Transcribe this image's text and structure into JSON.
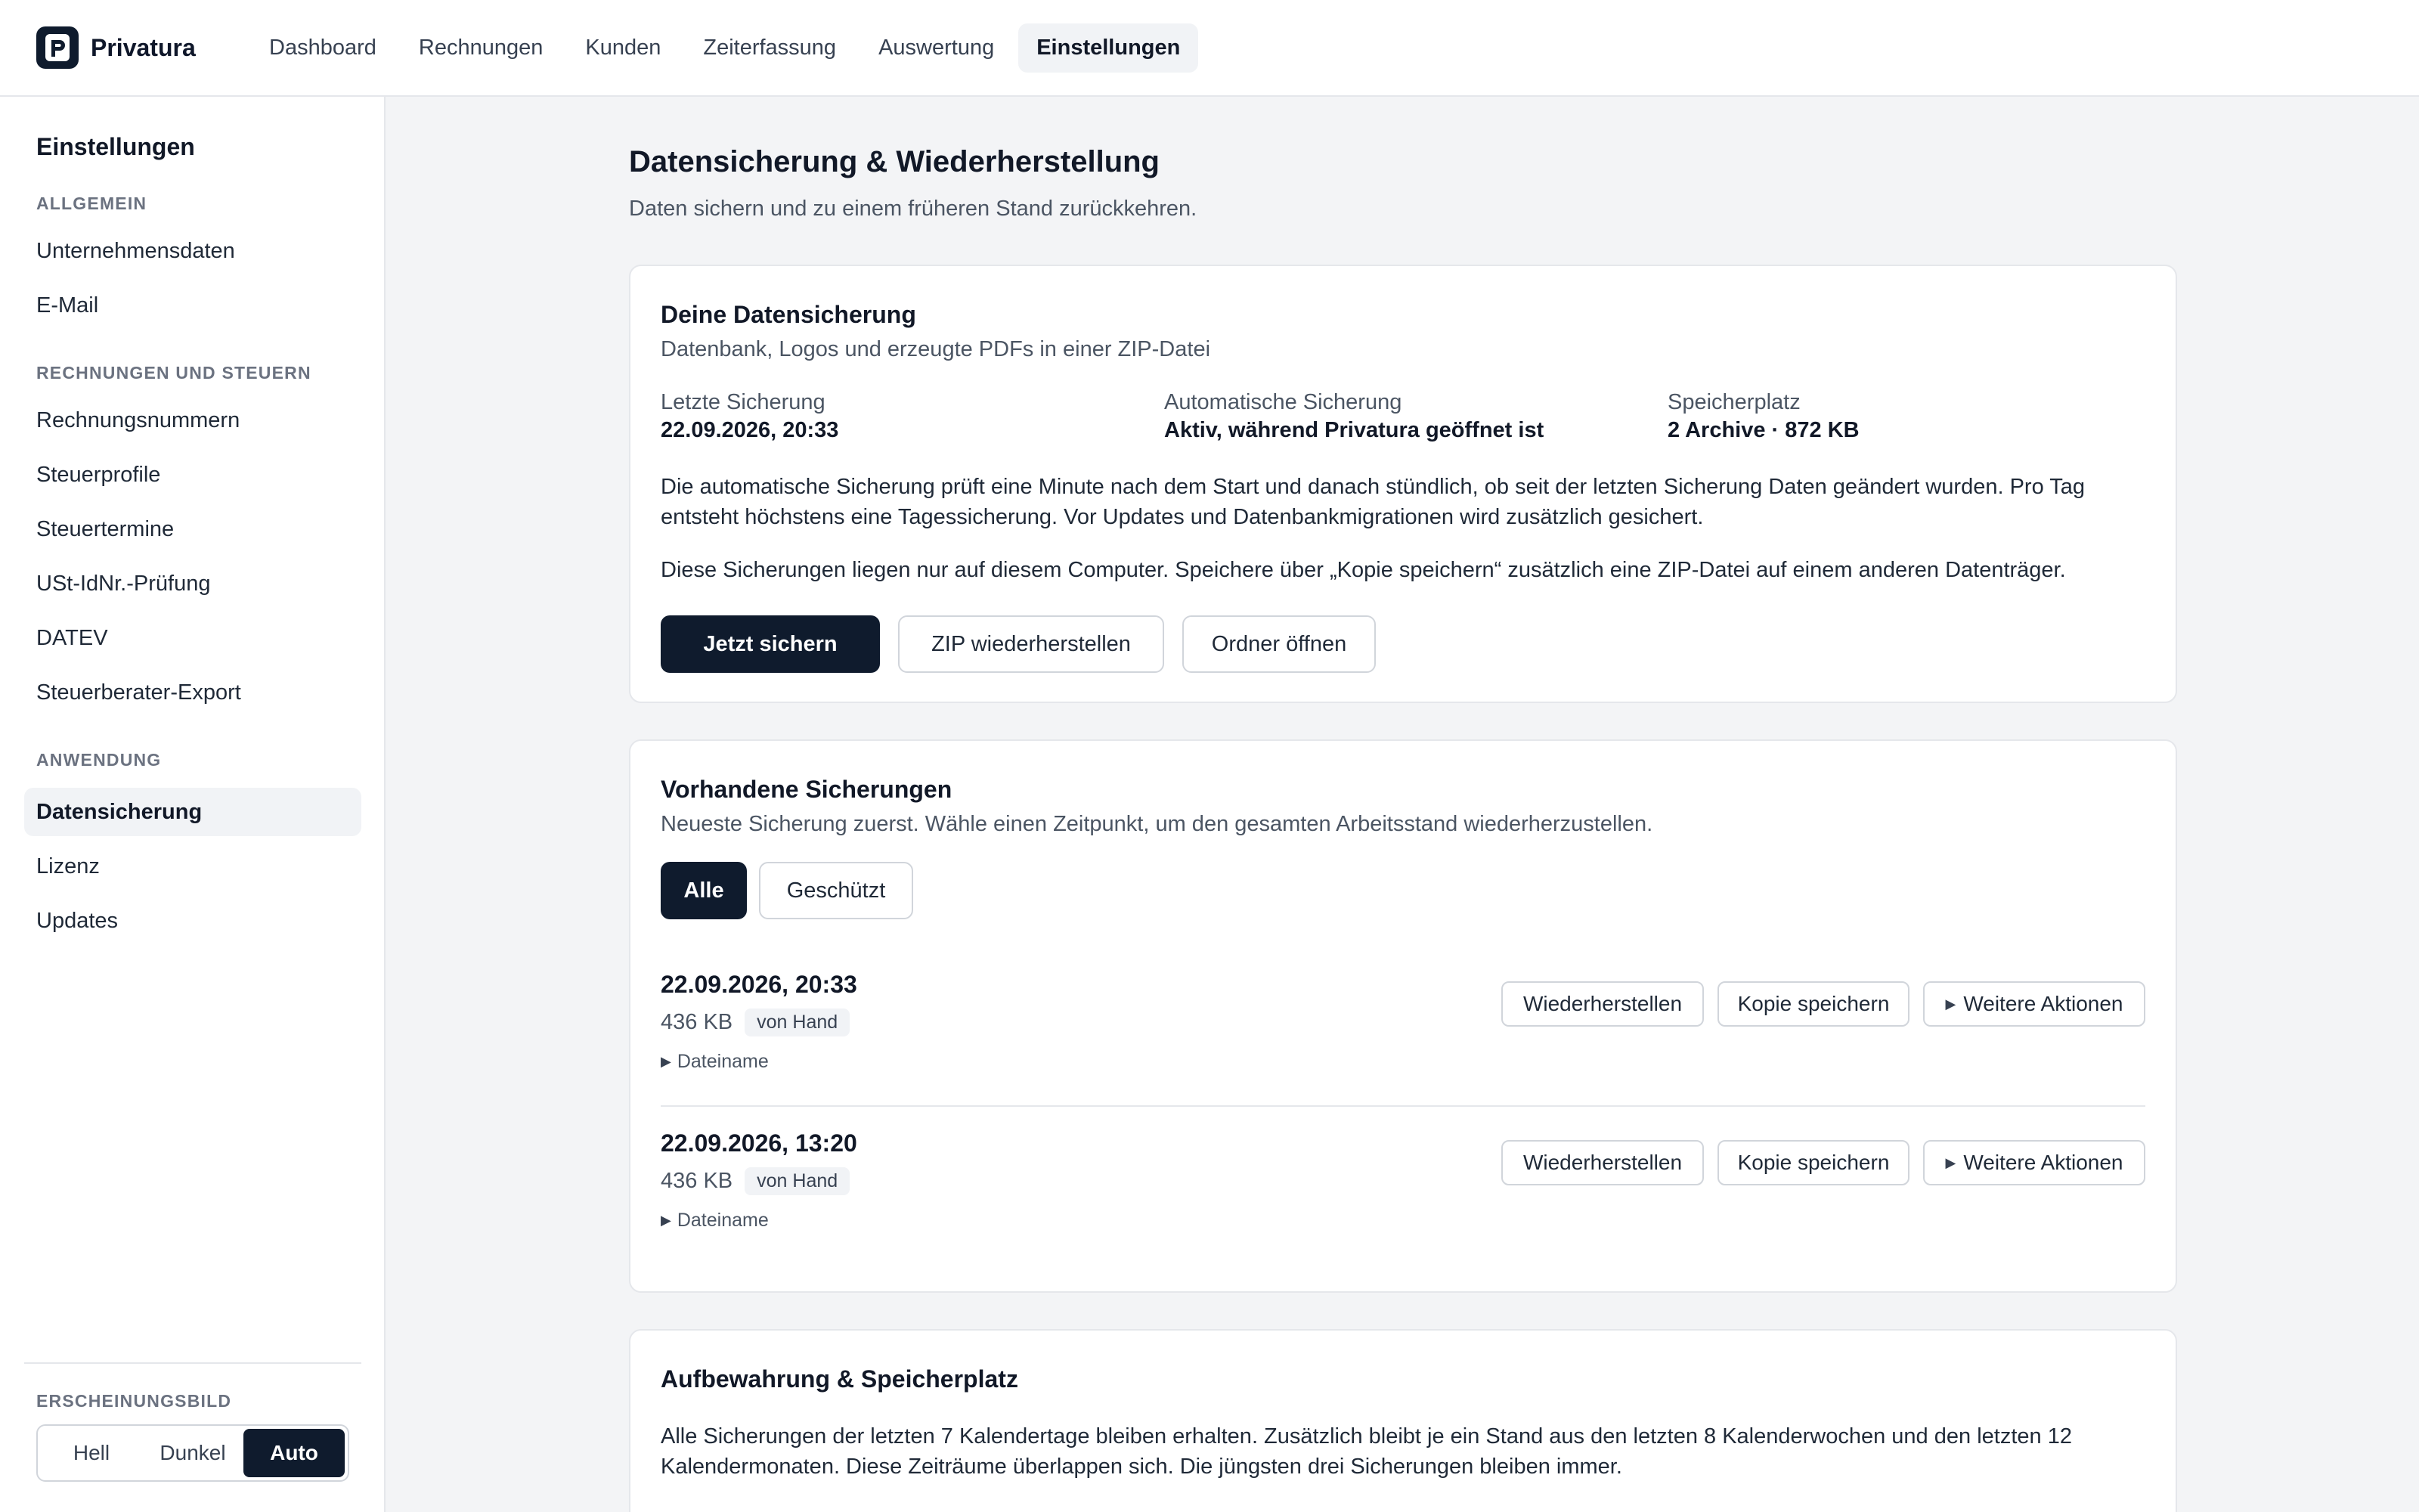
{
  "app": {
    "name": "Privatura"
  },
  "nav": {
    "items": [
      {
        "label": "Dashboard"
      },
      {
        "label": "Rechnungen"
      },
      {
        "label": "Kunden"
      },
      {
        "label": "Zeiterfassung"
      },
      {
        "label": "Auswertung"
      },
      {
        "label": "Einstellungen",
        "active": true
      }
    ]
  },
  "sidebar": {
    "title": "Einstellungen",
    "sections": {
      "general": "ALLGEMEIN",
      "invoices": "RECHNUNGEN UND STEUERN",
      "application": "ANWENDUNG",
      "appearance": "ERSCHEINUNGSBILD"
    },
    "items": {
      "company": "Unternehmensdaten",
      "email": "E-Mail",
      "invoice_numbers": "Rechnungsnummern",
      "tax_profiles": "Steuerprofile",
      "tax_dates": "Steuertermine",
      "vat_check": "USt-IdNr.-Prüfung",
      "datev": "DATEV",
      "advisor_export": "Steuerberater-Export",
      "backup": "Datensicherung",
      "license": "Lizenz",
      "updates": "Updates"
    },
    "theme": {
      "light": "Hell",
      "dark": "Dunkel",
      "auto": "Auto",
      "selected": "Auto"
    }
  },
  "page": {
    "title": "Datensicherung & Wiederherstellung",
    "subtitle": "Daten sichern und zu einem früheren Stand zurückkehren."
  },
  "backup_card": {
    "title": "Deine Datensicherung",
    "subtitle": "Datenbank, Logos und erzeugte PDFs in einer ZIP-Datei",
    "stats": {
      "last_label": "Letzte Sicherung",
      "last_value": "22.09.2026, 20:33",
      "auto_label": "Automatische Sicherung",
      "auto_value": "Aktiv, während Privatura geöffnet ist",
      "storage_label": "Speicherplatz",
      "storage_value": "2 Archive · 872 KB"
    },
    "para1": "Die automatische Sicherung prüft eine Minute nach dem Start und danach stündlich, ob seit der letzten Sicherung Daten geändert wurden. Pro Tag entsteht höchstens eine Tagessicherung. Vor Updates und Datenbankmigrationen wird zusätzlich gesichert.",
    "para2": "Diese Sicherungen liegen nur auf diesem Computer. Speichere über „Kopie speichern“ zusätzlich eine ZIP-Datei auf einem anderen Datenträger.",
    "buttons": {
      "backup_now": "Jetzt sichern",
      "restore_zip": "ZIP wiederherstellen",
      "open_folder": "Ordner öffnen"
    }
  },
  "existing_card": {
    "title": "Vorhandene Sicherungen",
    "subtitle": "Neueste Sicherung zuerst. Wähle einen Zeitpunkt, um den gesamten Arbeitsstand wiederherzustellen.",
    "filters": {
      "all": "Alle",
      "protected": "Geschützt",
      "selected": "Alle"
    },
    "rows": [
      {
        "date": "22.09.2026, 20:33",
        "size": "436 KB",
        "badge": "von Hand",
        "details": "Dateiname"
      },
      {
        "date": "22.09.2026, 13:20",
        "size": "436 KB",
        "badge": "von Hand",
        "details": "Dateiname"
      }
    ],
    "actions": {
      "restore": "Wiederherstellen",
      "save_copy": "Kopie speichern",
      "more": "Weitere Aktionen"
    }
  },
  "retention_card": {
    "title": "Aufbewahrung & Speicherplatz",
    "para": "Alle Sicherungen der letzten 7 Kalendertage bleiben erhalten. Zusätzlich bleibt je ein Stand aus den letzten 8 Kalenderwochen und den letzten 12 Kalendermonaten. Diese Zeiträume überlappen sich. Die jüngsten drei Sicherungen bleiben immer."
  },
  "colors": {
    "primary": "#0f1b2d",
    "active_bg": "#f1f3f6",
    "border": "#e5e7eb"
  },
  "icons": {
    "logo": "privatura-logo-icon",
    "disclosure": "triangle-right-icon"
  }
}
